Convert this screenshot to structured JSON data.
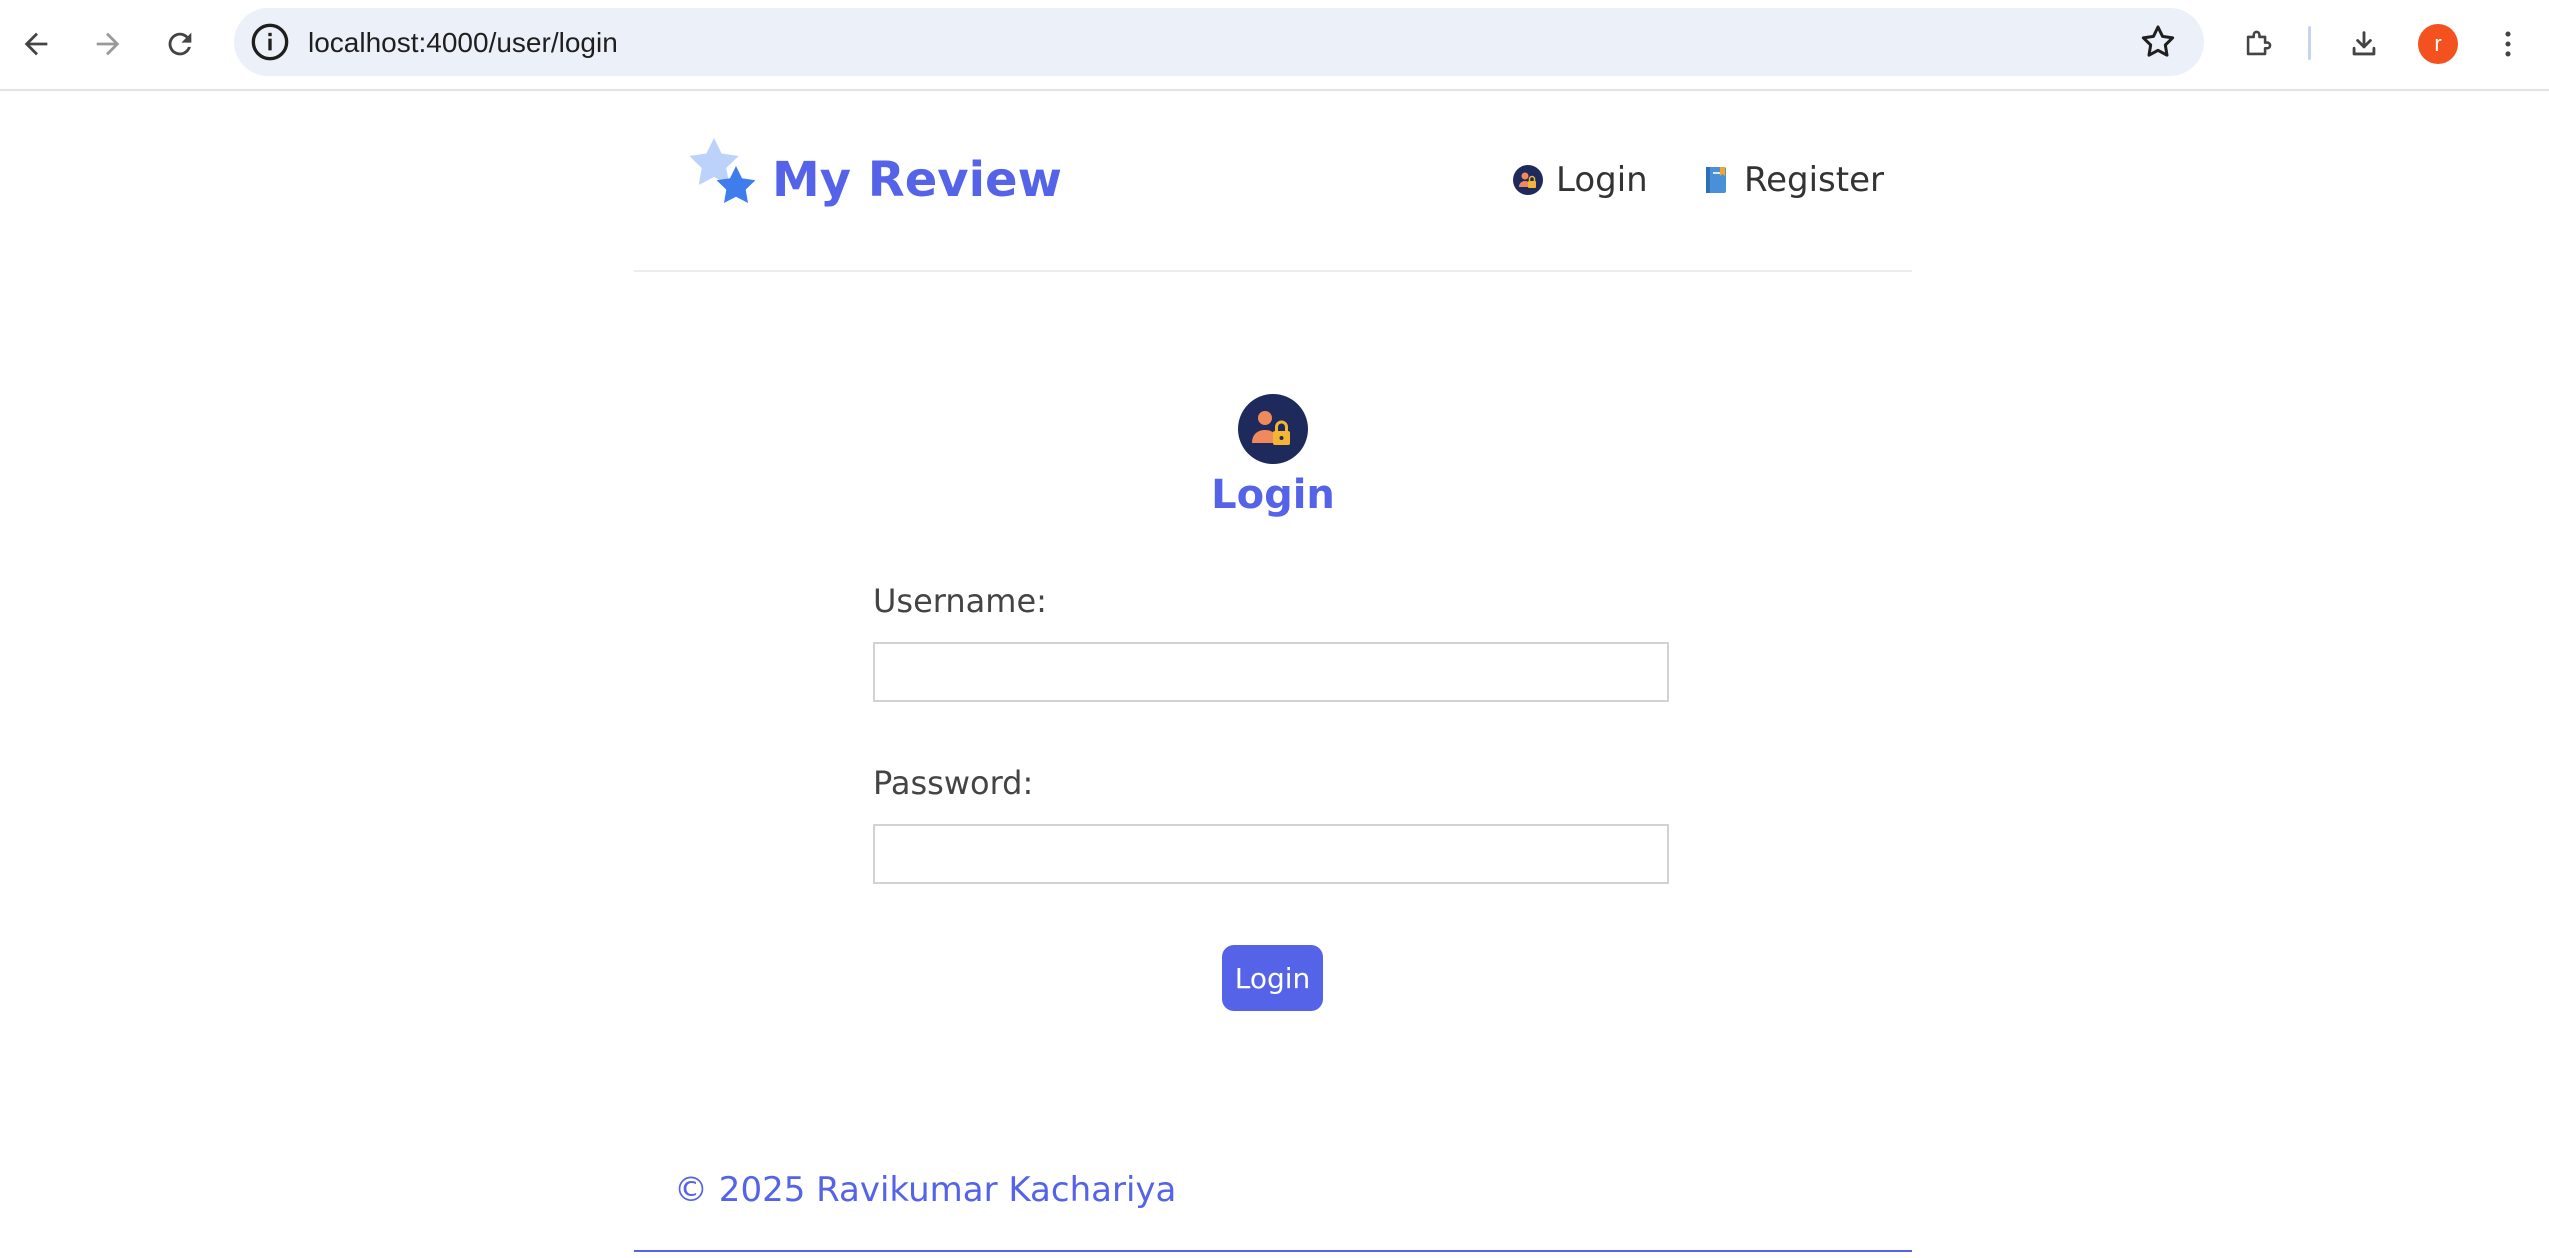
{
  "browser": {
    "url": "localhost:4000/user/login",
    "profile_initial": "r",
    "profile_color": "#f3511e",
    "icons": [
      "back-arrow-icon",
      "forward-arrow-icon",
      "reload-icon",
      "site-info-icon",
      "bookmark-star-icon",
      "extensions-puzzle-icon",
      "download-icon",
      "kebab-menu-icon"
    ]
  },
  "site": {
    "brand": "My Review",
    "accent_color": "#5463e7",
    "nav": {
      "login": "Login",
      "register": "Register"
    }
  },
  "login_form": {
    "title": "Login",
    "username_label": "Username:",
    "username_value": "",
    "password_label": "Password:",
    "password_value": "",
    "submit_label": "Login"
  },
  "footer": {
    "copyright": "© 2025 Ravikumar Kachariya"
  }
}
